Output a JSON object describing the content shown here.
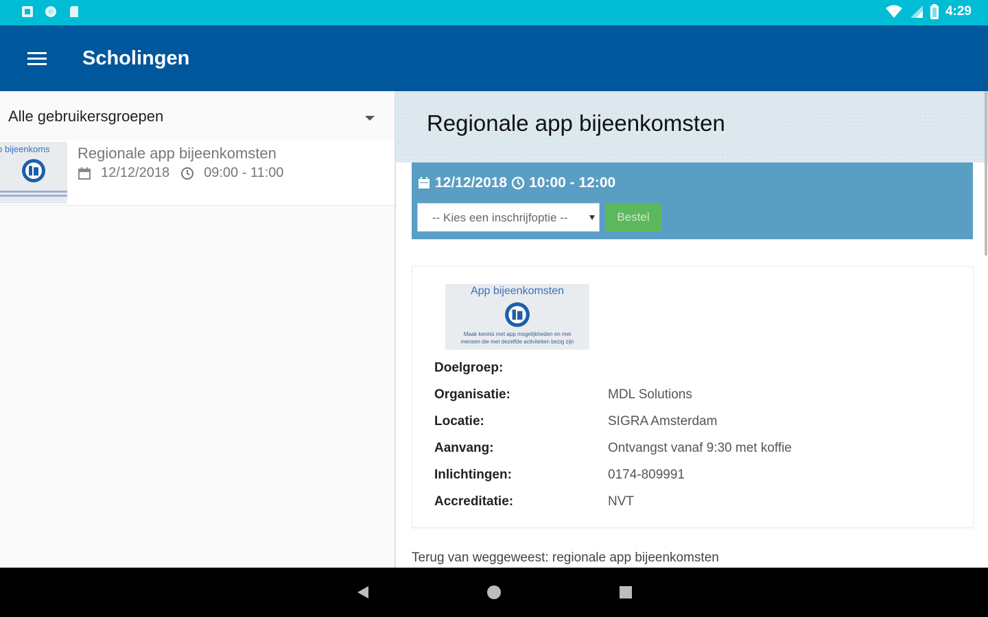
{
  "status_bar": {
    "time": "4:29",
    "left_icons": [
      "notification-icon",
      "circle-icon",
      "sd-card-icon"
    ],
    "right_icons": [
      "wifi-icon",
      "signal-icon",
      "battery-icon"
    ]
  },
  "app_bar": {
    "title": "Scholingen",
    "menu_icon": "hamburger-menu-icon",
    "color": "#01579b"
  },
  "left_pane": {
    "group_filter": "Alle gebruikersgroepen",
    "events": [
      {
        "thumb_title": "p bijeenkoms",
        "title": "Regionale app bijeenkomsten",
        "date": "12/12/2018",
        "time": "09:00 - 11:00"
      }
    ]
  },
  "detail": {
    "title": "Regionale app bijeenkomsten",
    "session": {
      "date": "12/12/2018",
      "time": "10:00 - 12:00",
      "option_placeholder": "-- Kies een inschrijfoptie --",
      "order_label": "Bestel"
    },
    "image": {
      "title": "App bijeenkomsten",
      "caption_line1": "Maak kennis met app mogelijkheden en met",
      "caption_line2": "mensen die met dezelfde activiteiten bezig zijn"
    },
    "fields": [
      {
        "label": "Doelgroep:",
        "value": ""
      },
      {
        "label": "Organisatie:",
        "value": "MDL Solutions"
      },
      {
        "label": "Locatie:",
        "value": "SIGRA Amsterdam"
      },
      {
        "label": "Aanvang:",
        "value": "Ontvangst vanaf 9:30 met koffie"
      },
      {
        "label": "Inlichtingen:",
        "value": "0174-809991"
      },
      {
        "label": "Accreditatie:",
        "value": "NVT"
      }
    ],
    "footer_text": "Terug van weggeweest: regionale app bijeenkomsten"
  },
  "colors": {
    "status_bar": "#00bcd4",
    "app_bar": "#01579b",
    "session_box": "#5a9ec4",
    "order_button": "#5cb85c"
  }
}
